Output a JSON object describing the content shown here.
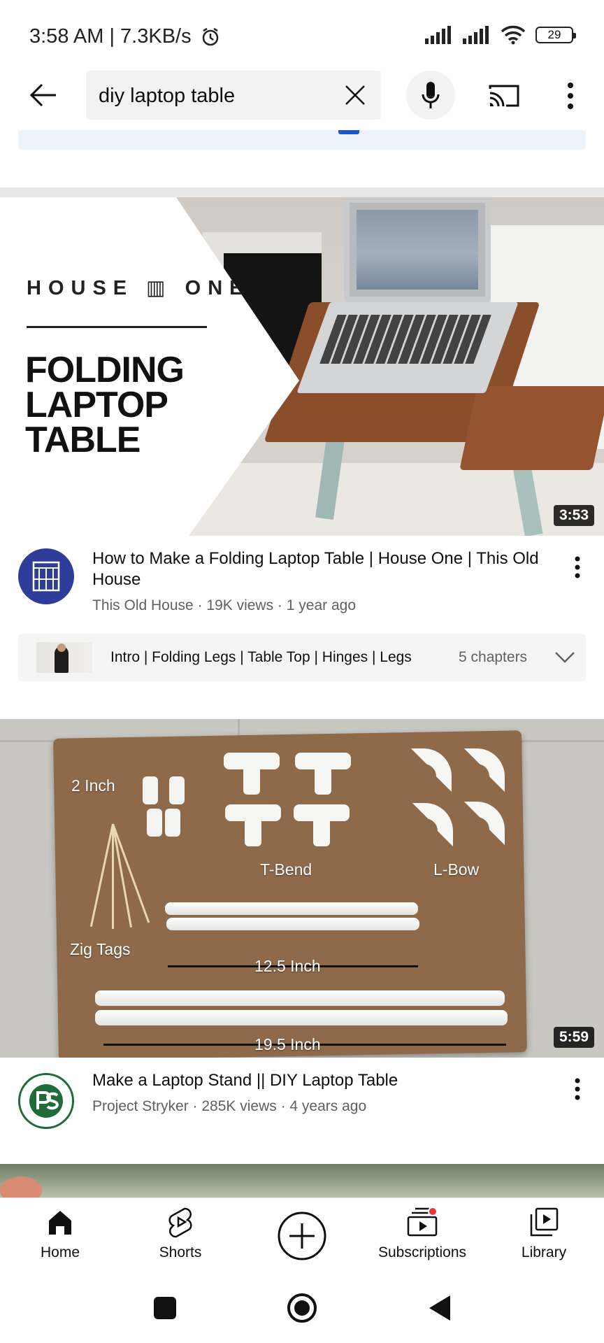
{
  "status_bar": {
    "time": "3:58 AM | 7.3KB/s",
    "battery": "29",
    "icons": [
      "alarm-icon",
      "signal-icon",
      "signal-icon",
      "wifi-icon",
      "battery-icon"
    ]
  },
  "header": {
    "search_query": "diy laptop table",
    "icons": [
      "back-arrow-icon",
      "clear-icon",
      "microphone-icon",
      "cast-icon",
      "more-vert-icon"
    ]
  },
  "videos": [
    {
      "thumb_brand": "HOUSE ▥ ONE",
      "thumb_title": "FOLDING LAPTOP TABLE",
      "duration": "3:53",
      "title": "How to Make a Folding Laptop Table | House One | This Old House",
      "channel_meta": "This Old House · 19K views · 1 year ago",
      "chapters_text": "Intro | Folding Legs | Table Top | Hinges | Legs",
      "chapters_count": "5 chapters"
    },
    {
      "duration": "5:59",
      "title": "Make a Laptop Stand || DIY Laptop Table",
      "channel_meta": "Project Stryker · 285K views · 4 years ago",
      "photo_labels": {
        "inch2": "2 Inch",
        "tbend": "T-Bend",
        "lbow": "L-Bow",
        "zig": "Zig Tags",
        "len1": "12.5 Inch",
        "len2": "19.5 Inch"
      }
    }
  ],
  "bottom_nav": {
    "home": "Home",
    "shorts": "Shorts",
    "subscriptions": "Subscriptions",
    "library": "Library"
  },
  "colors": {
    "text_primary": "#0f0f0f",
    "text_secondary": "#606060",
    "accent_blue": "#1a57c7",
    "notification_red": "#e53935"
  }
}
